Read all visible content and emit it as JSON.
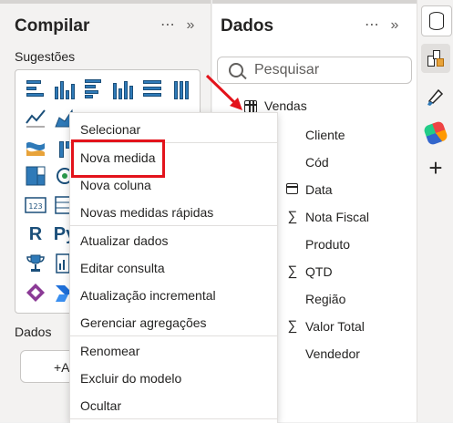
{
  "build_pane": {
    "title": "Compilar",
    "more_icon": "⋯",
    "collapse_icon": "»",
    "suggestions_label": "Sugestões",
    "data_section_label": "Dados",
    "add_button_label": "+A",
    "visuals": [
      {
        "icon": "stacked-bar-chart-icon"
      },
      {
        "icon": "stacked-column-chart-icon"
      },
      {
        "icon": "clustered-bar-chart-icon"
      },
      {
        "icon": "clustered-column-chart-icon"
      },
      {
        "icon": "100-percent-bar-chart-icon"
      },
      {
        "icon": "100-percent-column-chart-icon"
      },
      {
        "icon": "line-chart-icon"
      },
      {
        "icon": "area-chart-icon"
      },
      {
        "icon": "ribbon-chart-icon"
      },
      {
        "icon": "waterfall-chart-icon"
      },
      {
        "icon": "treemap-icon"
      },
      {
        "icon": "map-icon"
      },
      {
        "icon": "card-icon",
        "glyph": "123"
      },
      {
        "icon": "table-visual-icon"
      },
      {
        "icon": "r-script-icon",
        "glyph": "R"
      },
      {
        "icon": "python-script-icon",
        "glyph": "Py"
      },
      {
        "icon": "trophy-icon"
      },
      {
        "icon": "paginated-report-icon"
      },
      {
        "icon": "power-apps-icon"
      },
      {
        "icon": "power-automate-icon"
      }
    ]
  },
  "data_pane": {
    "title": "Dados",
    "more_icon": "⋯",
    "collapse_icon": "»",
    "search_placeholder": "Pesquisar",
    "table": {
      "name": "Vendas",
      "icon": "table-icon"
    },
    "fields": [
      {
        "label": "Cliente",
        "icon": ""
      },
      {
        "label": "Cód",
        "icon": ""
      },
      {
        "label": "Data",
        "icon": "calendar-icon"
      },
      {
        "label": "Nota Fiscal",
        "icon": "sigma-icon",
        "glyph": "∑"
      },
      {
        "label": "Produto",
        "icon": ""
      },
      {
        "label": "QTD",
        "icon": "sigma-icon",
        "glyph": "∑"
      },
      {
        "label": "Região",
        "icon": ""
      },
      {
        "label": "Valor Total",
        "icon": "sigma-icon",
        "glyph": "∑"
      },
      {
        "label": "Vendedor",
        "icon": ""
      }
    ]
  },
  "rail": {
    "items": [
      {
        "icon": "data-cylinder-icon",
        "active": true
      },
      {
        "icon": "model-icon"
      },
      {
        "icon": "format-brush-icon"
      },
      {
        "icon": "copilot-icon"
      },
      {
        "icon": "plus-icon",
        "glyph": "+"
      }
    ]
  },
  "context_menu": {
    "highlighted_item": "Nova medida",
    "highlight_color": "#e3131b",
    "items": [
      "Selecionar",
      "Nova medida",
      "Nova coluna",
      "Novas medidas rápidas",
      "Atualizar dados",
      "Editar consulta",
      "Atualização incremental",
      "Gerenciar agregações",
      "Renomear",
      "Excluir do modelo",
      "Ocultar"
    ]
  },
  "colors": {
    "accent_red": "#e3131b",
    "visual_blue": "#2f7ab8"
  }
}
